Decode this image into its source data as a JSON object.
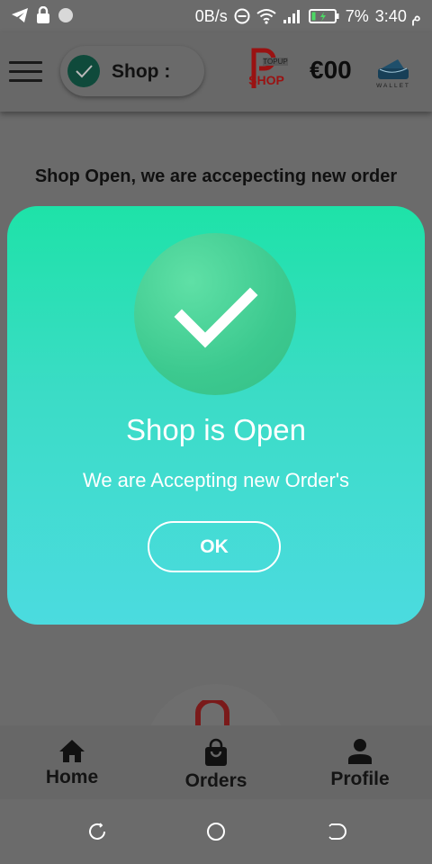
{
  "status_bar": {
    "net_speed": "0B/s",
    "battery": "7%",
    "time": "3:40 م",
    "icons": [
      "telegram-icon",
      "lock-icon",
      "dot-icon",
      "dnd-icon",
      "wifi-icon",
      "signal-icon",
      "battery-icon"
    ]
  },
  "header": {
    "shop_label": "Shop :",
    "logo_alt": "TOPUP SHOP",
    "balance": "€00",
    "wallet_label": "WALLET"
  },
  "main": {
    "shop_status_message": "Shop Open, we are accepecting new order"
  },
  "dialog": {
    "title": "Shop is Open",
    "message": "We are Accepting new Order's",
    "ok_label": "OK",
    "colors": {
      "top": "#1ee2a8",
      "bottom": "#4bdbdf"
    }
  },
  "bottom_nav": {
    "items": [
      {
        "label": "Home",
        "icon": "home-icon"
      },
      {
        "label": "Orders",
        "icon": "shopping-bag-icon"
      },
      {
        "label": "Profile",
        "icon": "person-icon"
      }
    ]
  },
  "system_nav": {
    "buttons": [
      "recents-icon",
      "home-circle-icon",
      "back-icon"
    ]
  }
}
